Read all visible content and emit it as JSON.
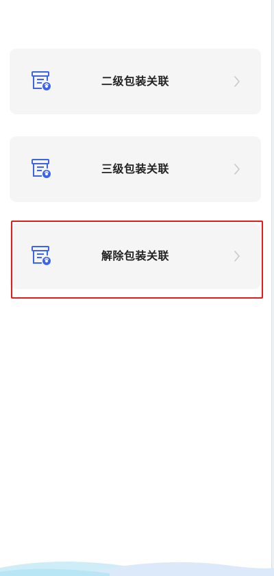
{
  "menu": {
    "items": [
      {
        "label": "二级包装关联",
        "icon": "package-link-icon",
        "chevron": "chevron-right-icon"
      },
      {
        "label": "三级包装关联",
        "icon": "package-link-icon",
        "chevron": "chevron-right-icon"
      },
      {
        "label": "解除包装关联",
        "icon": "package-link-icon",
        "chevron": "chevron-right-icon"
      }
    ],
    "highlighted_index": 2
  },
  "colors": {
    "icon_blue": "#3d63e8",
    "card_background": "#f5f5f5",
    "label_text": "#222222",
    "chevron": "#c8c8c8",
    "highlight": "#e31b1b"
  }
}
